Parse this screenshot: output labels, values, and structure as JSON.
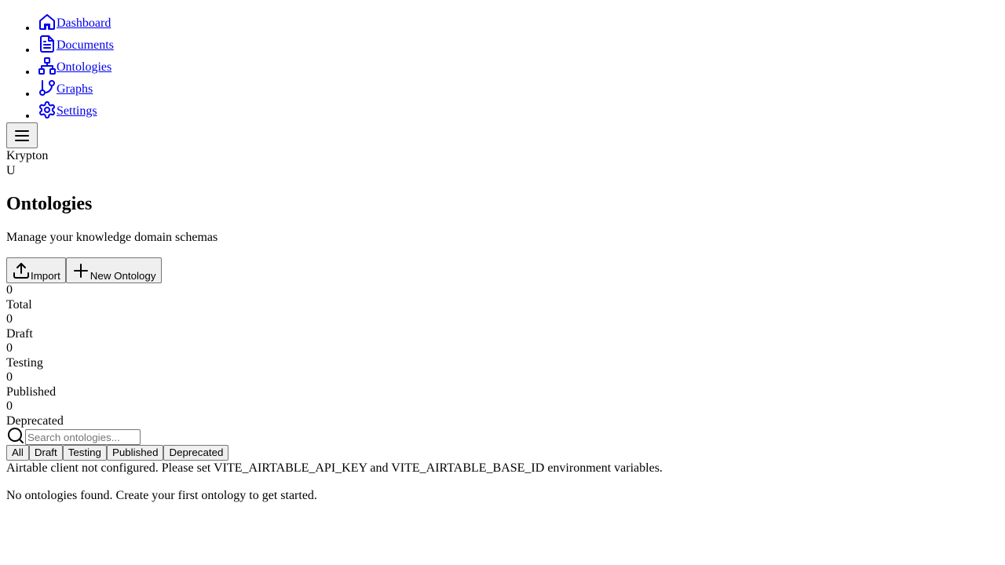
{
  "nav": {
    "items": [
      {
        "label": "Dashboard",
        "icon": "home-icon"
      },
      {
        "label": "Documents",
        "icon": "document-icon"
      },
      {
        "label": "Ontologies",
        "icon": "network-icon"
      },
      {
        "label": "Graphs",
        "icon": "git-branch-icon"
      },
      {
        "label": "Settings",
        "icon": "gear-icon"
      }
    ]
  },
  "header": {
    "menu_icon": "menu-icon",
    "brand": "Krypton",
    "avatar": "U"
  },
  "page": {
    "title": "Ontologies",
    "subtitle": "Manage your knowledge domain schemas"
  },
  "actions": {
    "import_label": "Import",
    "new_label": "New Ontology"
  },
  "stats": [
    {
      "value": "0",
      "label": "Total"
    },
    {
      "value": "0",
      "label": "Draft"
    },
    {
      "value": "0",
      "label": "Testing"
    },
    {
      "value": "0",
      "label": "Published"
    },
    {
      "value": "0",
      "label": "Deprecated"
    }
  ],
  "search": {
    "placeholder": "Search ontologies...",
    "value": ""
  },
  "filters": [
    "All",
    "Draft",
    "Testing",
    "Published",
    "Deprecated"
  ],
  "messages": {
    "error": "Airtable client not configured. Please set VITE_AIRTABLE_API_KEY and VITE_AIRTABLE_BASE_ID environment variables.",
    "empty": "No ontologies found. Create your first ontology to get started."
  },
  "colors": {
    "link": "#0000ee",
    "button_bg": "#efefef",
    "button_border": "#767676"
  }
}
